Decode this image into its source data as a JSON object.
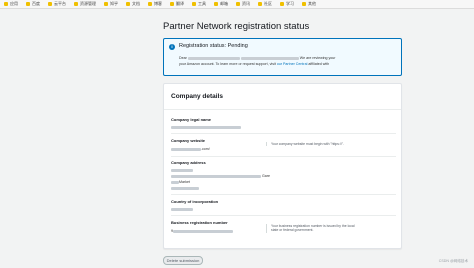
{
  "bookmarks": [
    {
      "label": "应用"
    },
    {
      "label": "百度"
    },
    {
      "label": "云平台"
    },
    {
      "label": "资源管理"
    },
    {
      "label": "知乎"
    },
    {
      "label": "文档"
    },
    {
      "label": "博客"
    },
    {
      "label": "翻译"
    },
    {
      "label": "工具"
    },
    {
      "label": "邮箱"
    },
    {
      "label": "资讯"
    },
    {
      "label": "社区"
    },
    {
      "label": "学习"
    },
    {
      "label": "其他"
    }
  ],
  "page": {
    "title": "Partner Network registration status"
  },
  "alert": {
    "icon": "info-icon",
    "title": "Registration status: Pending",
    "line1_prefix": "Dear",
    "line1_suffix": "We are reviewing your",
    "line2_prefix": "your Amazon account. To learn more or request support, visit",
    "line2_link": "our Partner Central",
    "line2_suffix": "affiliated with"
  },
  "details": {
    "title": "Company details",
    "fields": {
      "legal_name_label": "Company legal name",
      "website_label": "Company website",
      "website_value_suffix": ".com/",
      "website_hint": "Your company website must begin with \"https://\".",
      "address_label": "Company address",
      "address_line2_suffix": "Gare",
      "address_line3_suffix": "Market",
      "country_label": "Country of incorporation",
      "reg_number_label": "Business registration number",
      "reg_number_prefix": "9",
      "reg_number_hint": "Your business registration number is issued by the local state or federal government."
    }
  },
  "actions": {
    "delete_label": "Delete submission"
  },
  "watermark": "CSDN @网络技术"
}
